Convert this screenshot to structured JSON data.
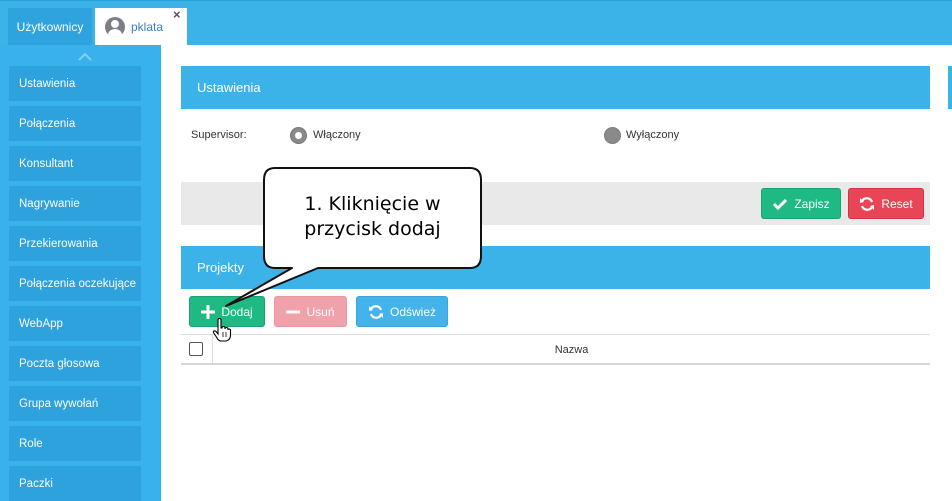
{
  "tabs": {
    "users_label": "Użytkownicy",
    "user_label": "pklata",
    "close_symbol": "×"
  },
  "sidebar": {
    "collapse_icon": "chevron-up-icon",
    "items": [
      {
        "label": "Ustawienia"
      },
      {
        "label": "Połączenia"
      },
      {
        "label": "Konsultant"
      },
      {
        "label": "Nagrywanie"
      },
      {
        "label": "Przekierowania"
      },
      {
        "label": "Połączenia oczekujące"
      },
      {
        "label": "WebApp"
      },
      {
        "label": "Poczta głosowa"
      },
      {
        "label": "Grupa wywołań"
      },
      {
        "label": "Role"
      },
      {
        "label": "Paczki"
      }
    ]
  },
  "settings": {
    "title": "Ustawienia",
    "supervisor_label": "Supervisor:",
    "option_on": "Włączony",
    "option_off": "Wyłączony",
    "selected": "Włączony",
    "save_label": "Zapisz",
    "reset_label": "Reset"
  },
  "projects": {
    "title": "Projekty",
    "add_label": "Dodaj",
    "remove_label": "Usuń",
    "refresh_label": "Odśwież",
    "columns": [
      "Nazwa"
    ]
  },
  "callout": {
    "line1": "1. Kliknięcie w",
    "line2": "przycisk dodaj"
  },
  "colors": {
    "accent": "#3cb3e8",
    "sidebar_item": "#2ea2dc",
    "success": "#1fba83",
    "danger": "#e84556",
    "danger_disabled": "#f0a1aa"
  }
}
